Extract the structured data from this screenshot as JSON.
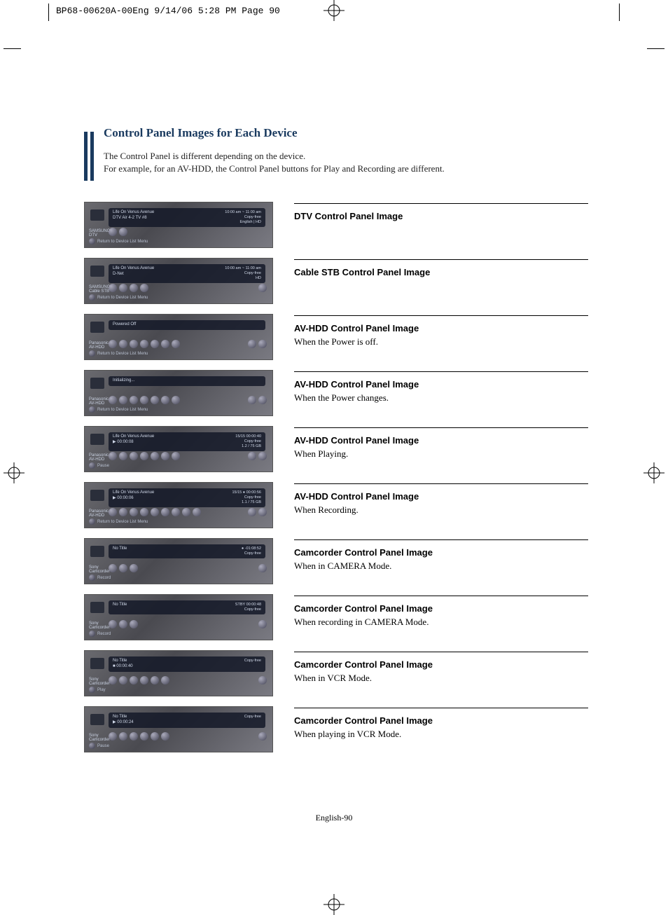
{
  "header": "BP68-00620A-00Eng  9/14/06  5:28 PM  Page 90",
  "title": "Control Panel Images for Each Device",
  "intro1": "The Control Panel is different depending on the device.",
  "intro2": "For example, for an AV-HDD, the Control Panel buttons for Play and Recording are different.",
  "page_number": "English-90",
  "common": {
    "return_menu": "Return to Device List Menu",
    "pause": "Pause",
    "play": "Play",
    "record": "Record",
    "life_on_venus": "Life On Venus Avenue",
    "no_title": "No Title",
    "copy_free": "Copy-free"
  },
  "sections": [
    {
      "heading": "DTV Control Panel Image",
      "desc": "",
      "osd": {
        "line1": "Life On Venus Avenue",
        "line2": "DTV Air  4-2  TV #8",
        "r1": "10:00 am ~ 11:00 am",
        "r2": "Copy-free",
        "r3": "English | HD",
        "device": "SAMSUNG\nDTV",
        "footer": "Return to Device List Menu",
        "buttons": 2,
        "rbuttons": 0
      }
    },
    {
      "heading": "Cable STB Control Panel Image",
      "desc": "",
      "osd": {
        "line1": "Life On Venus Avenue",
        "line2": "D-Net",
        "r1": "10:00 am ~ 11:00 am",
        "r2": "Copy-free",
        "r3": "HD",
        "device": "SAMSUNG\nCable STB",
        "footer": "Return to Device List Menu",
        "buttons": 4,
        "rbuttons": 1
      }
    },
    {
      "heading": "AV-HDD Control Panel Image",
      "desc": "When the Power is off.",
      "osd": {
        "line1": "Powered Off",
        "line2": "",
        "r1": "",
        "r2": "",
        "r3": "",
        "device": "Panasonic\nAV-HDD",
        "footer": "Return to Device List Menu",
        "buttons": 7,
        "rbuttons": 2
      }
    },
    {
      "heading": "AV-HDD Control Panel Image",
      "desc": "When the Power changes.",
      "osd": {
        "line1": "Initializing...",
        "line2": "",
        "r1": "",
        "r2": "",
        "r3": "",
        "device": "Panasonic\nAV-HDD",
        "footer": "Return to Device List Menu",
        "buttons": 7,
        "rbuttons": 2
      }
    },
    {
      "heading": "AV-HDD Control Panel Image",
      "desc": "When Playing.",
      "osd": {
        "line1": "Life On Venus Avenue",
        "line2": "▶  00:00:08",
        "r1": "15/15       00:00:40",
        "r2": "Copy-free",
        "r3": "1.2 / 75 GB",
        "device": "Panasonic\nAV-HDD",
        "footer": "Pause",
        "buttons": 7,
        "rbuttons": 2
      }
    },
    {
      "heading": "AV-HDD Control Panel Image",
      "desc": "When Recording.",
      "osd": {
        "line1": "Life On Venus Avenue",
        "line2": "▶  00:00:06",
        "r1": "15/15     ● 00:00:56",
        "r2": "Copy-free",
        "r3": "1.1 / 75 GB",
        "device": "Panasonic\nAV-HDD",
        "footer": "Return to Device List Menu",
        "buttons": 9,
        "rbuttons": 2
      }
    },
    {
      "heading": "Camcorder Control Panel Image",
      "desc": "When in CAMERA Mode.",
      "osd": {
        "line1": "No Title",
        "line2": "",
        "r1": "●  -01:08:52",
        "r2": "Copy-free",
        "r3": "",
        "device": "Sony\nCamcorder",
        "footer": "Record",
        "buttons": 3,
        "rbuttons": 1
      }
    },
    {
      "heading": "Camcorder Control Panel Image",
      "desc": "When recording in CAMERA Mode.",
      "osd": {
        "line1": "No Title",
        "line2": "",
        "r1": "STBY   00:00:48",
        "r2": "Copy-free",
        "r3": "",
        "device": "Sony\nCamcorder",
        "footer": "Record",
        "buttons": 3,
        "rbuttons": 1
      }
    },
    {
      "heading": "Camcorder Control Panel Image",
      "desc": "When in VCR Mode.",
      "osd": {
        "line1": "No Title",
        "line2": "■  00:00:40",
        "r1": "",
        "r2": "Copy-free",
        "r3": "",
        "device": "Sony\nCamcorder",
        "footer": "Play",
        "buttons": 6,
        "rbuttons": 1
      }
    },
    {
      "heading": "Camcorder Control Panel Image",
      "desc": "When playing in VCR Mode.",
      "osd": {
        "line1": "No Title",
        "line2": "▶  00:00:24",
        "r1": "",
        "r2": "Copy-free",
        "r3": "",
        "device": "Sony\nCamcorder",
        "footer": "Pause",
        "buttons": 6,
        "rbuttons": 1
      }
    }
  ]
}
